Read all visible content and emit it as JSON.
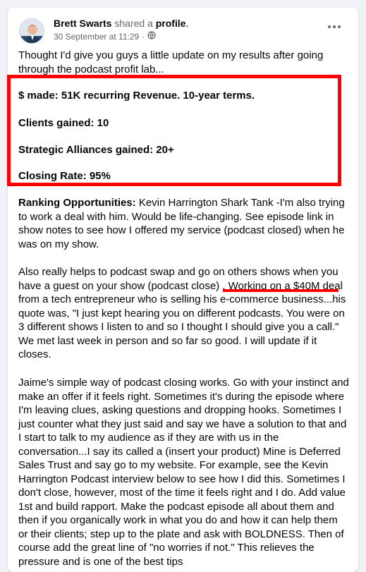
{
  "post": {
    "author_name": "Brett Swarts",
    "action_text": " shared a ",
    "target_text": "profile",
    "target_suffix": ".",
    "timestamp": "30 September at 11:29",
    "separator": "·",
    "intro": "Thought I'd give you guys a little update on my results after going through the podcast profit lab...",
    "stats": [
      "$ made: 51K recurring Revenue. 10-year terms.",
      "Clients gained: 10",
      "Strategic Alliances gained: 20+",
      "Closing Rate: 95%"
    ],
    "ranking_label": "Ranking Opportunities:",
    "ranking_text": " Kevin Harrington Shark Tank -I'm also trying to work a deal with him. Would be life-changing. See episode link in show notes to see how I offered my service (podcast closed) when he was on my show.",
    "swap_text": "Also really helps to podcast swap and go on others shows when you have a guest on your show (podcast close) . Working on a $40M deal from a tech entrepreneur who is selling his e-commerce business...his quote was, \"I just kept hearing you on different podcasts. You were on 3 different shows I listen to and so I thought I should give you a call.\" We met last week in person and so far so good. I will update if it closes.",
    "jaime_text": "Jaime's simple way of podcast closing works. Go with your instinct and make an offer if it feels right. Sometimes it's during the episode where I'm leaving clues, asking questions and dropping hooks. Sometimes I just counter what they just said and say we have a solution to that and I start to talk to my audience as if they are with us in the conversation...I say its called a (insert your product) Mine is Deferred Sales Trust and say go to my website. For example, see the Kevin Harrington Podcast interview below to see how I did this. Sometimes I don't close, however, most of the time it feels right and I do. Add value 1st and build rapport. Make the podcast episode all about them and then if you organically work in what you do and how it can help them or their clients; step up to the plate and ask with BOLDNESS. Then of course add the great line of \"no worries if not.\" This relieves the pressure and is one of the best tips"
  },
  "colors": {
    "highlight": "#ff0000",
    "text": "#050505",
    "secondary_text": "#65676b"
  },
  "icons": [
    "globe-icon",
    "more-options-icon"
  ]
}
